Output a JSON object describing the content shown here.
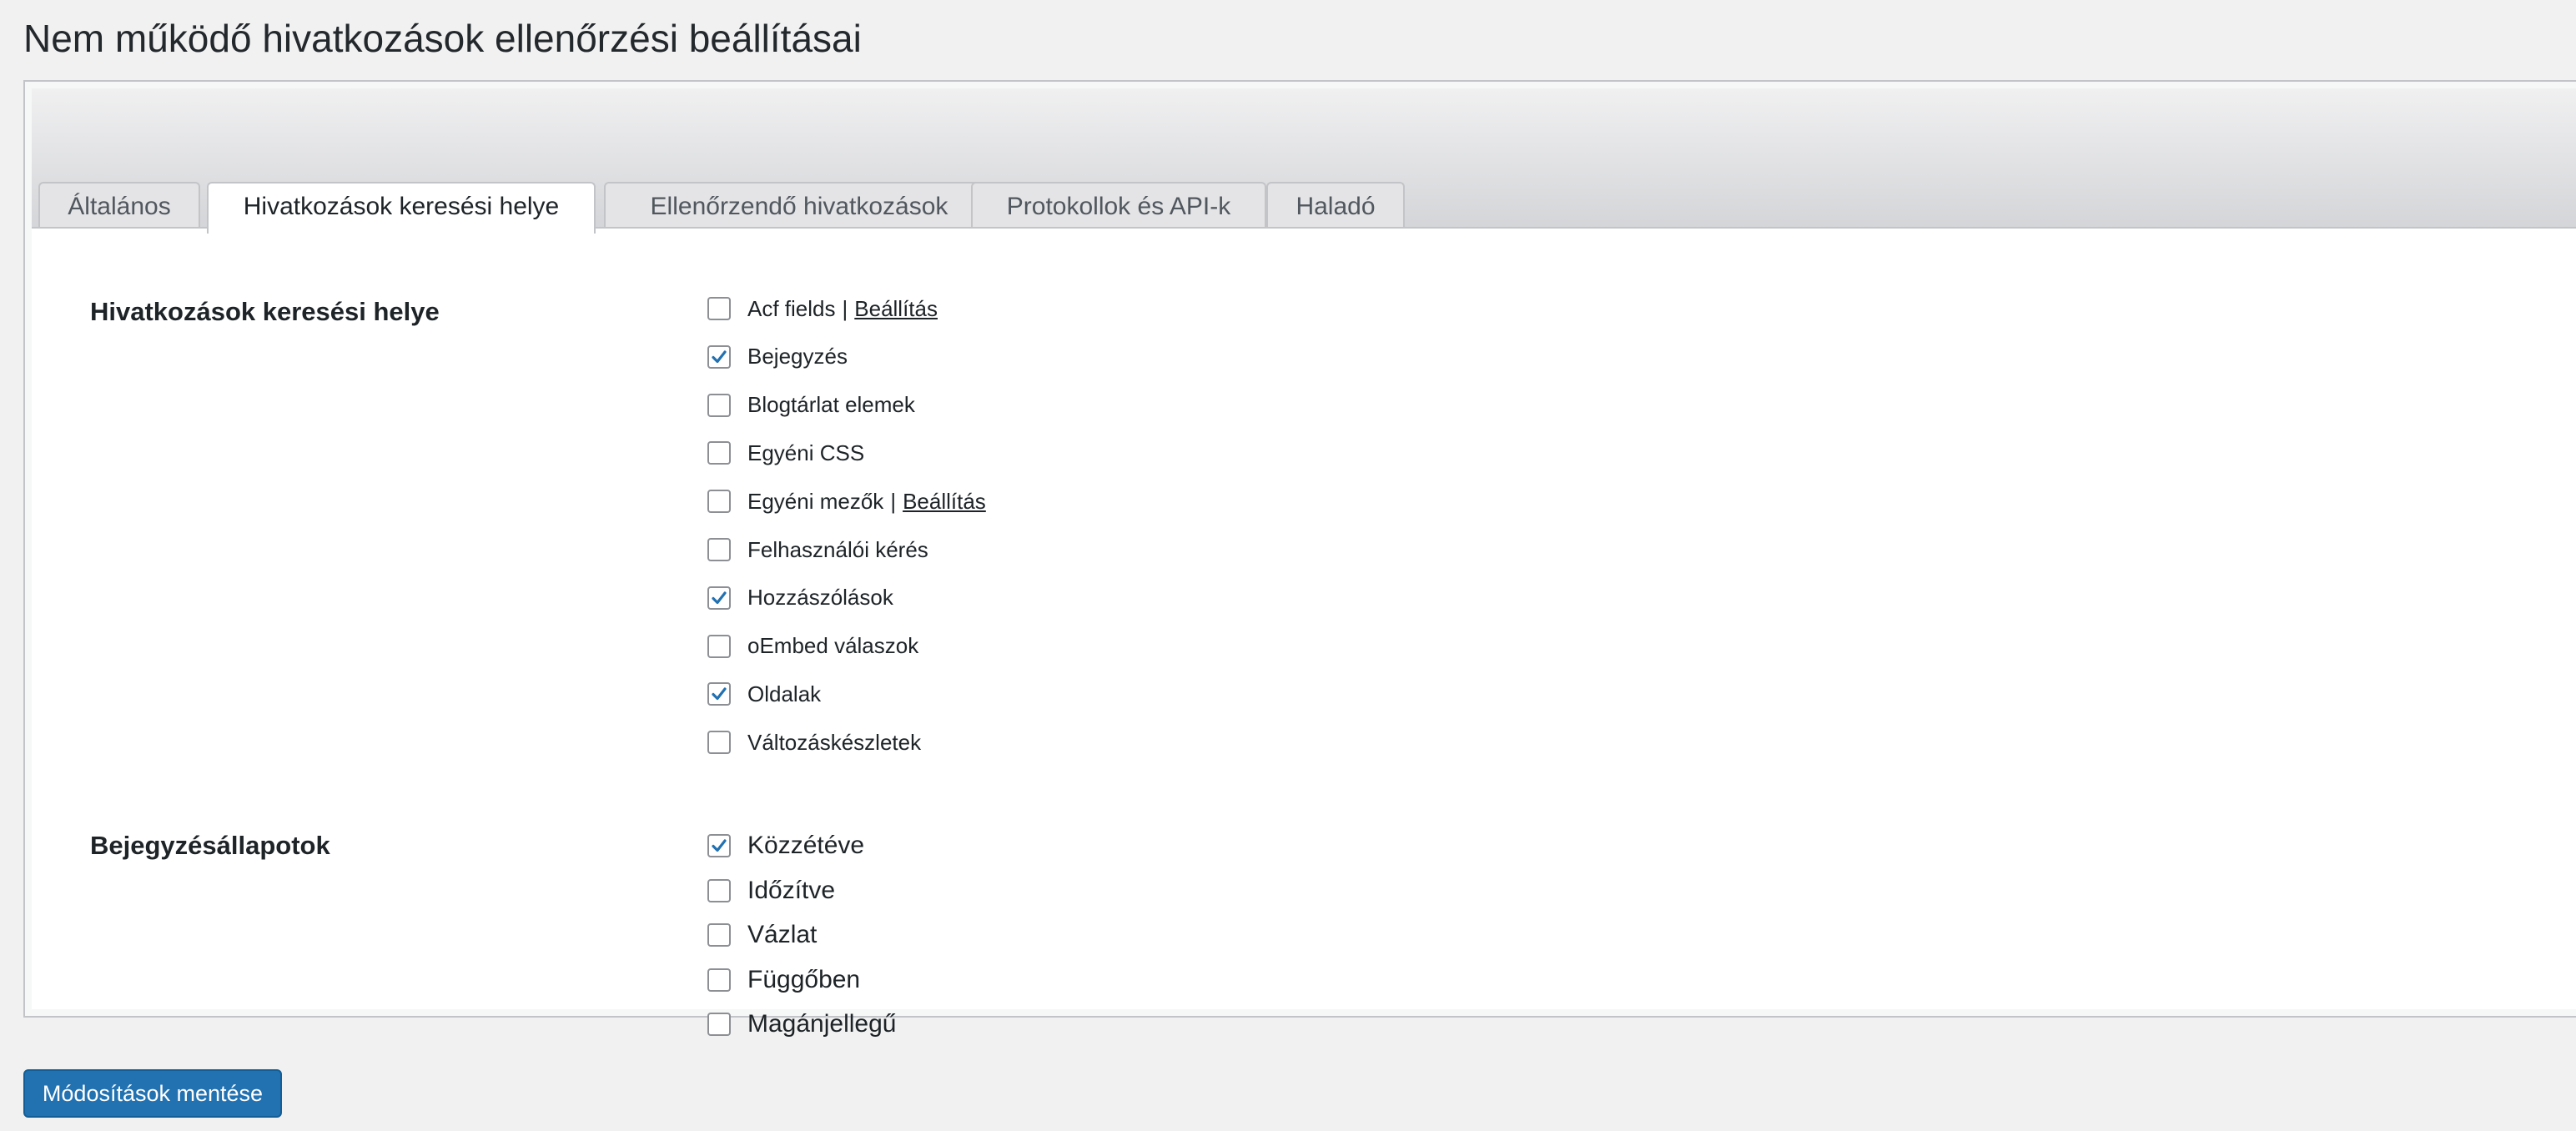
{
  "page": {
    "title": "Nem működő hivatkozások ellenőrzési beállításai"
  },
  "tabs": [
    {
      "label": "Általános",
      "active": false
    },
    {
      "label": "Hivatkozások keresési helye",
      "active": true
    },
    {
      "label": "Ellenőrzendő hivatkozások",
      "active": false
    },
    {
      "label": "Protokollok és API-k",
      "active": false
    },
    {
      "label": "Haladó",
      "active": false
    }
  ],
  "search_locations": {
    "label": "Hivatkozások keresési helye",
    "items": [
      {
        "label": "Acf fields",
        "checked": false,
        "separator": "|",
        "link": "Beállítás"
      },
      {
        "label": "Bejegyzés",
        "checked": true
      },
      {
        "label": "Blogtárlat elemek",
        "checked": false
      },
      {
        "label": "Egyéni CSS",
        "checked": false
      },
      {
        "label": "Egyéni mezők",
        "checked": false,
        "separator": "|",
        "link": "Beállítás"
      },
      {
        "label": "Felhasználói kérés",
        "checked": false
      },
      {
        "label": "Hozzászólások",
        "checked": true
      },
      {
        "label": "oEmbed válaszok",
        "checked": false
      },
      {
        "label": "Oldalak",
        "checked": true
      },
      {
        "label": "Változáskészletek",
        "checked": false
      }
    ]
  },
  "post_statuses": {
    "label": "Bejegyzésállapotok",
    "items": [
      {
        "label": "Közzétéve",
        "checked": true
      },
      {
        "label": "Időzítve",
        "checked": false
      },
      {
        "label": "Vázlat",
        "checked": false
      },
      {
        "label": "Függőben",
        "checked": false
      },
      {
        "label": "Magánjellegű",
        "checked": false
      }
    ]
  },
  "actions": {
    "save_label": "Módosítások mentése"
  },
  "colors": {
    "accent": "#2271b1",
    "background": "#f1f1f1",
    "panel": "#ffffff",
    "border": "#c3c4c7"
  },
  "icons": {
    "checkbox_checked": "checkmark-icon"
  }
}
